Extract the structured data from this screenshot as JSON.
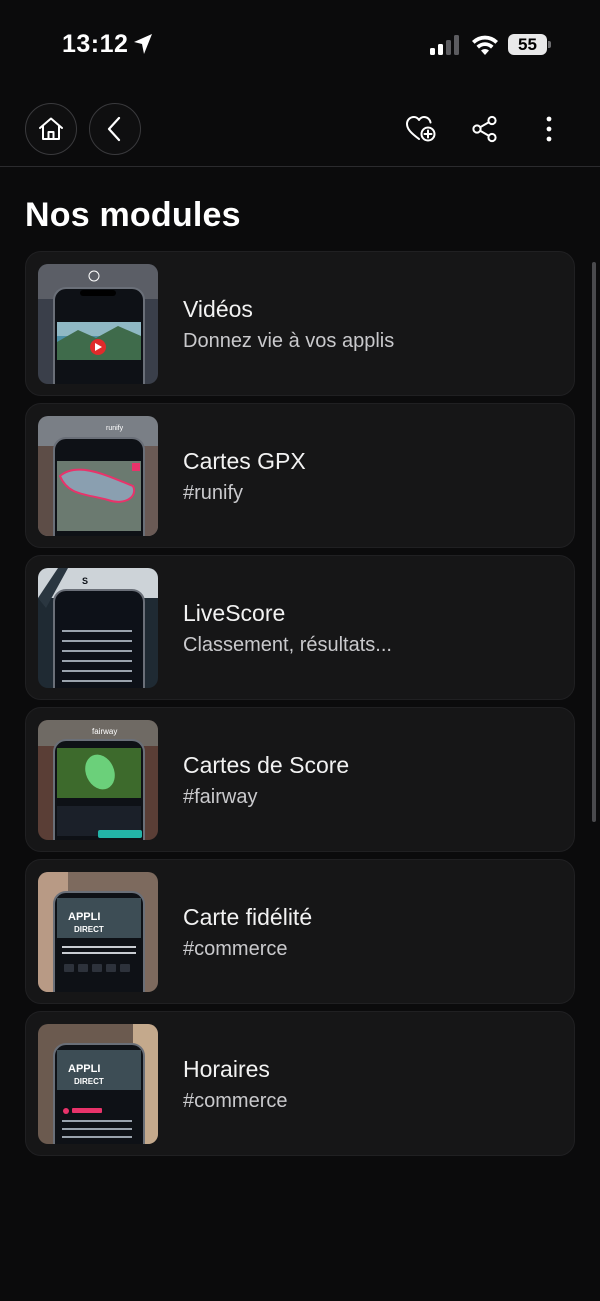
{
  "status_bar": {
    "time": "13:12",
    "battery": "55",
    "icons": [
      "location-arrow-icon",
      "cellular-signal-icon",
      "wifi-icon",
      "battery-icon"
    ]
  },
  "nav": {
    "icons": [
      "home-icon",
      "back-chevron-icon",
      "favorite-add-icon",
      "share-icon",
      "more-vertical-icon"
    ]
  },
  "page": {
    "title": "Nos modules"
  },
  "modules": [
    {
      "title": "Vidéos",
      "subtitle": "Donnez vie à vos applis"
    },
    {
      "title": "Cartes GPX",
      "subtitle": "#runify"
    },
    {
      "title": "LiveScore",
      "subtitle": "Classement, résultats..."
    },
    {
      "title": "Cartes de Score",
      "subtitle": "#fairway"
    },
    {
      "title": "Carte fidélité",
      "subtitle": "#commerce"
    },
    {
      "title": "Horaires",
      "subtitle": "#commerce"
    }
  ],
  "colors": {
    "background": "#0b0b0c",
    "card": "#161617",
    "accent_pink": "#e8336a"
  }
}
